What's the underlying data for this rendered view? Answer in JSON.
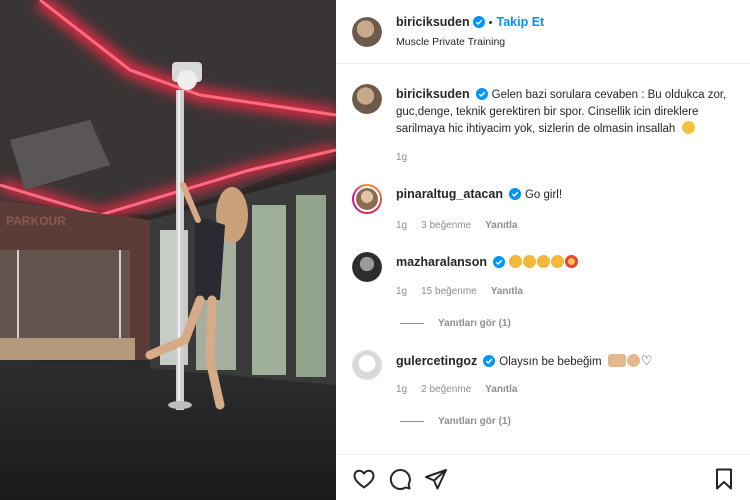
{
  "post": {
    "username": "biriciksuden",
    "follow_label": "Takip Et",
    "location": "Muscle Private Training",
    "caption": "Gelen bazi sorulara cevaben : Bu oldukca zor, guc,denge, teknik gerektiren bir spor. Cinsellik icin direklere sarilmaya hic ihtiyacim yok, sizlerin de olmasin insallah",
    "caption_time": "1g"
  },
  "comments": [
    {
      "username": "pinaraltug_atacan",
      "text": "Go girl!",
      "time": "1g",
      "likes": "3 beğenme",
      "reply_label": "Yanıtla"
    },
    {
      "username": "mazharalanson",
      "text": "",
      "time": "1g",
      "likes": "15 beğenme",
      "reply_label": "Yanıtla",
      "view_replies": "Yanıtları gör (1)"
    },
    {
      "username": "gulercetingoz",
      "text": "Olaysın be bebeğim",
      "time": "1g",
      "likes": "2 beğenme",
      "reply_label": "Yanıtla",
      "view_replies": "Yanıtları gör (1)"
    }
  ],
  "icons": [
    "heart-icon",
    "comment-icon",
    "share-icon",
    "bookmark-icon",
    "verified-icon"
  ],
  "colors": {
    "accent": "#0095f6",
    "muted": "#8e8e8e",
    "neon": "#ff2a48"
  }
}
